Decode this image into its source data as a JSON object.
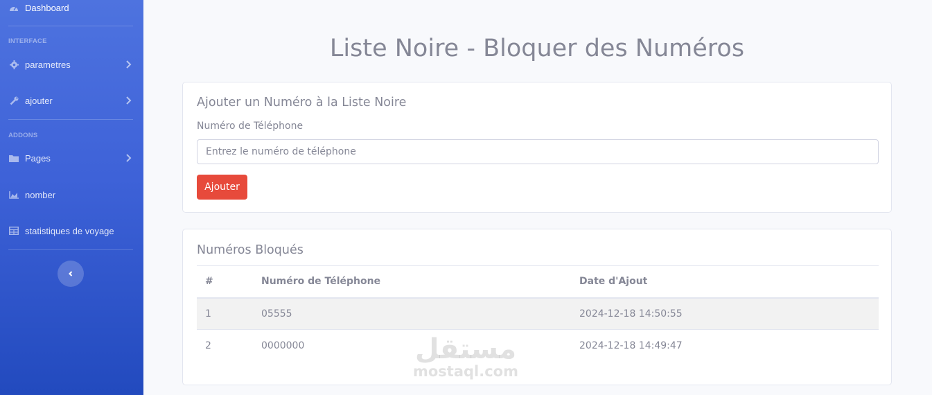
{
  "sidebar": {
    "dashboard": "Dashboard",
    "section_interface": "INTERFACE",
    "parametres": "parametres",
    "ajouter": "ajouter",
    "section_addons": "ADDONS",
    "pages": "Pages",
    "nomber": "nomber",
    "statistiques": "statistiques de voyage",
    "colors": {
      "gradient_top": "#4e73df",
      "gradient_bottom": "#224abe"
    }
  },
  "page": {
    "title": "Liste Noire - Bloquer des Numéros"
  },
  "add_form": {
    "title": "Ajouter un Numéro à la Liste Noire",
    "phone_label": "Numéro de Téléphone",
    "phone_placeholder": "Entrez le numéro de téléphone",
    "phone_value": "",
    "submit_label": "Ajouter",
    "submit_color": "#e74a3b"
  },
  "blocked": {
    "title": "Numéros Bloqués",
    "columns": [
      "#",
      "Numéro de Téléphone",
      "Date d'Ajout"
    ],
    "rows": [
      {
        "id": "1",
        "phone": "05555",
        "date": "2024-12-18 14:50:55"
      },
      {
        "id": "2",
        "phone": "0000000",
        "date": "2024-12-18 14:49:47"
      }
    ]
  },
  "watermark": {
    "arabic": "مستقل",
    "latin": "mostaql.com"
  }
}
